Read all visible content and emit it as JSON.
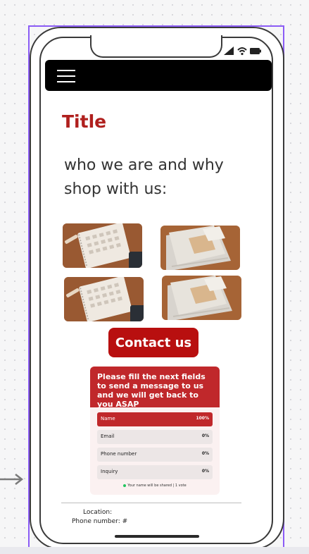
{
  "page": {
    "title": "Title",
    "intro": "who we are and why shop with us:",
    "contact_button": "Contact us"
  },
  "poll": {
    "header": "Please fill the next fields to send a message to us and we will get back to you ASAP",
    "options": [
      {
        "label": "Name",
        "percent": "100%",
        "fill": 1.0,
        "selected": true
      },
      {
        "label": "Email",
        "percent": "0%",
        "fill": 0.0,
        "selected": false
      },
      {
        "label": "Phone number",
        "percent": "0%",
        "fill": 0.0,
        "selected": false
      },
      {
        "label": "Inquiry",
        "percent": "0%",
        "fill": 0.0,
        "selected": false
      }
    ],
    "footer": "Your name will be shared | 1 vote"
  },
  "footer": {
    "location": "Location:",
    "phone": "Phone number: #"
  },
  "colors": {
    "accent": "#b0201e",
    "button": "#b80f0f",
    "poll_header": "#c0282b",
    "selection_frame": "#8b5cf6"
  },
  "icons": [
    "menu-icon",
    "signal-icon",
    "wifi-icon",
    "battery-icon",
    "arrow-right-icon"
  ]
}
